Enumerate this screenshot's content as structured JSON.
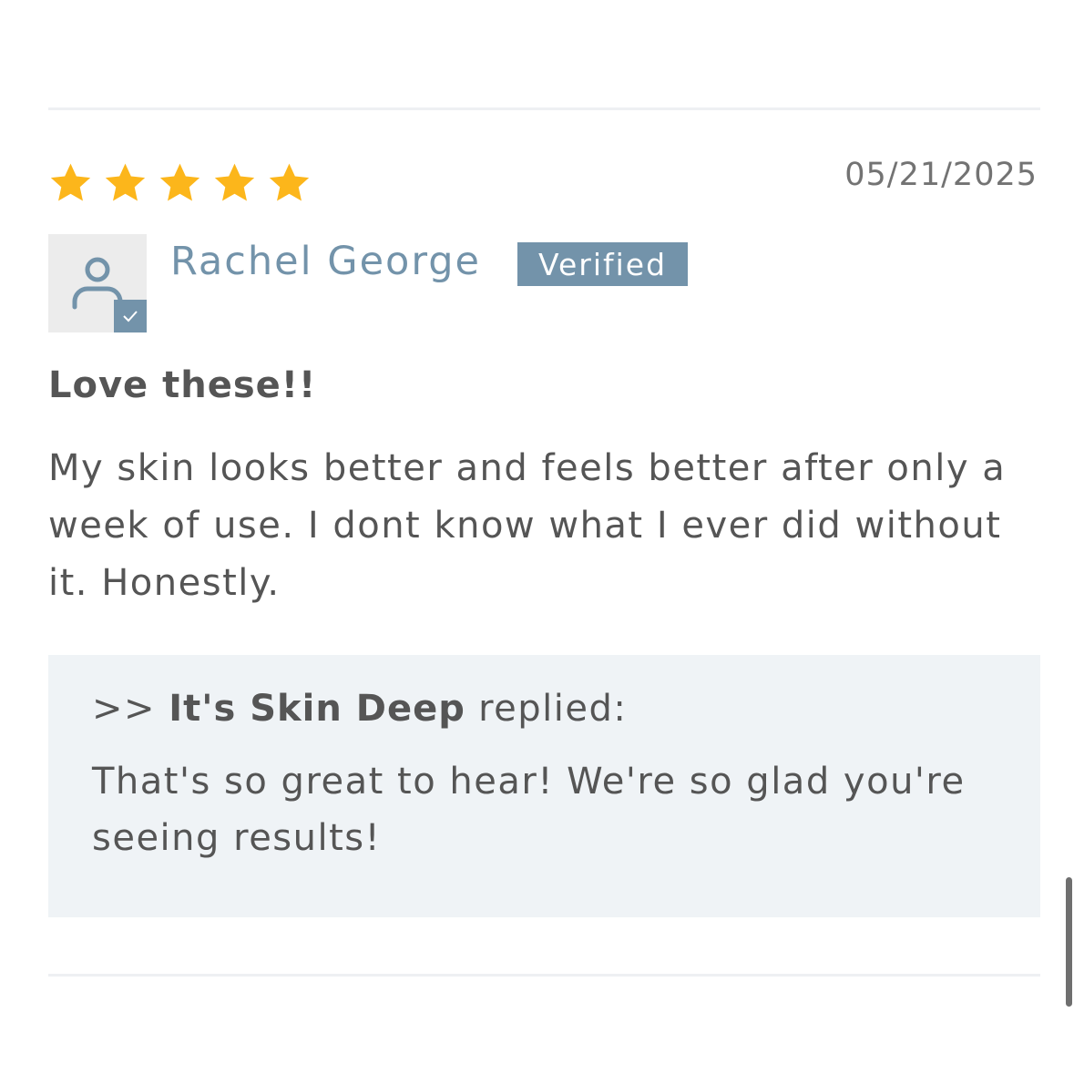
{
  "review": {
    "rating": 5,
    "max_rating": 5,
    "star_color": "#fcb61b",
    "date": "05/21/2025",
    "reviewer": {
      "name": "Rachel George",
      "avatar_icon": "person-icon",
      "verified_icon": "check-icon"
    },
    "verified_label": "Verified",
    "title": "Love these!!",
    "body": "My skin looks better and feels better after only a week of use. I dont know what I ever did without it. Honestly."
  },
  "reply": {
    "prefix": ">>",
    "store_name": "It's Skin Deep",
    "suffix": "replied:",
    "body": "That's so great to hear! We're so glad you're seeing results!"
  },
  "colors": {
    "accent": "#7393aa",
    "text": "#555555",
    "reply_background": "#eff3f6",
    "avatar_background": "#ececec"
  }
}
